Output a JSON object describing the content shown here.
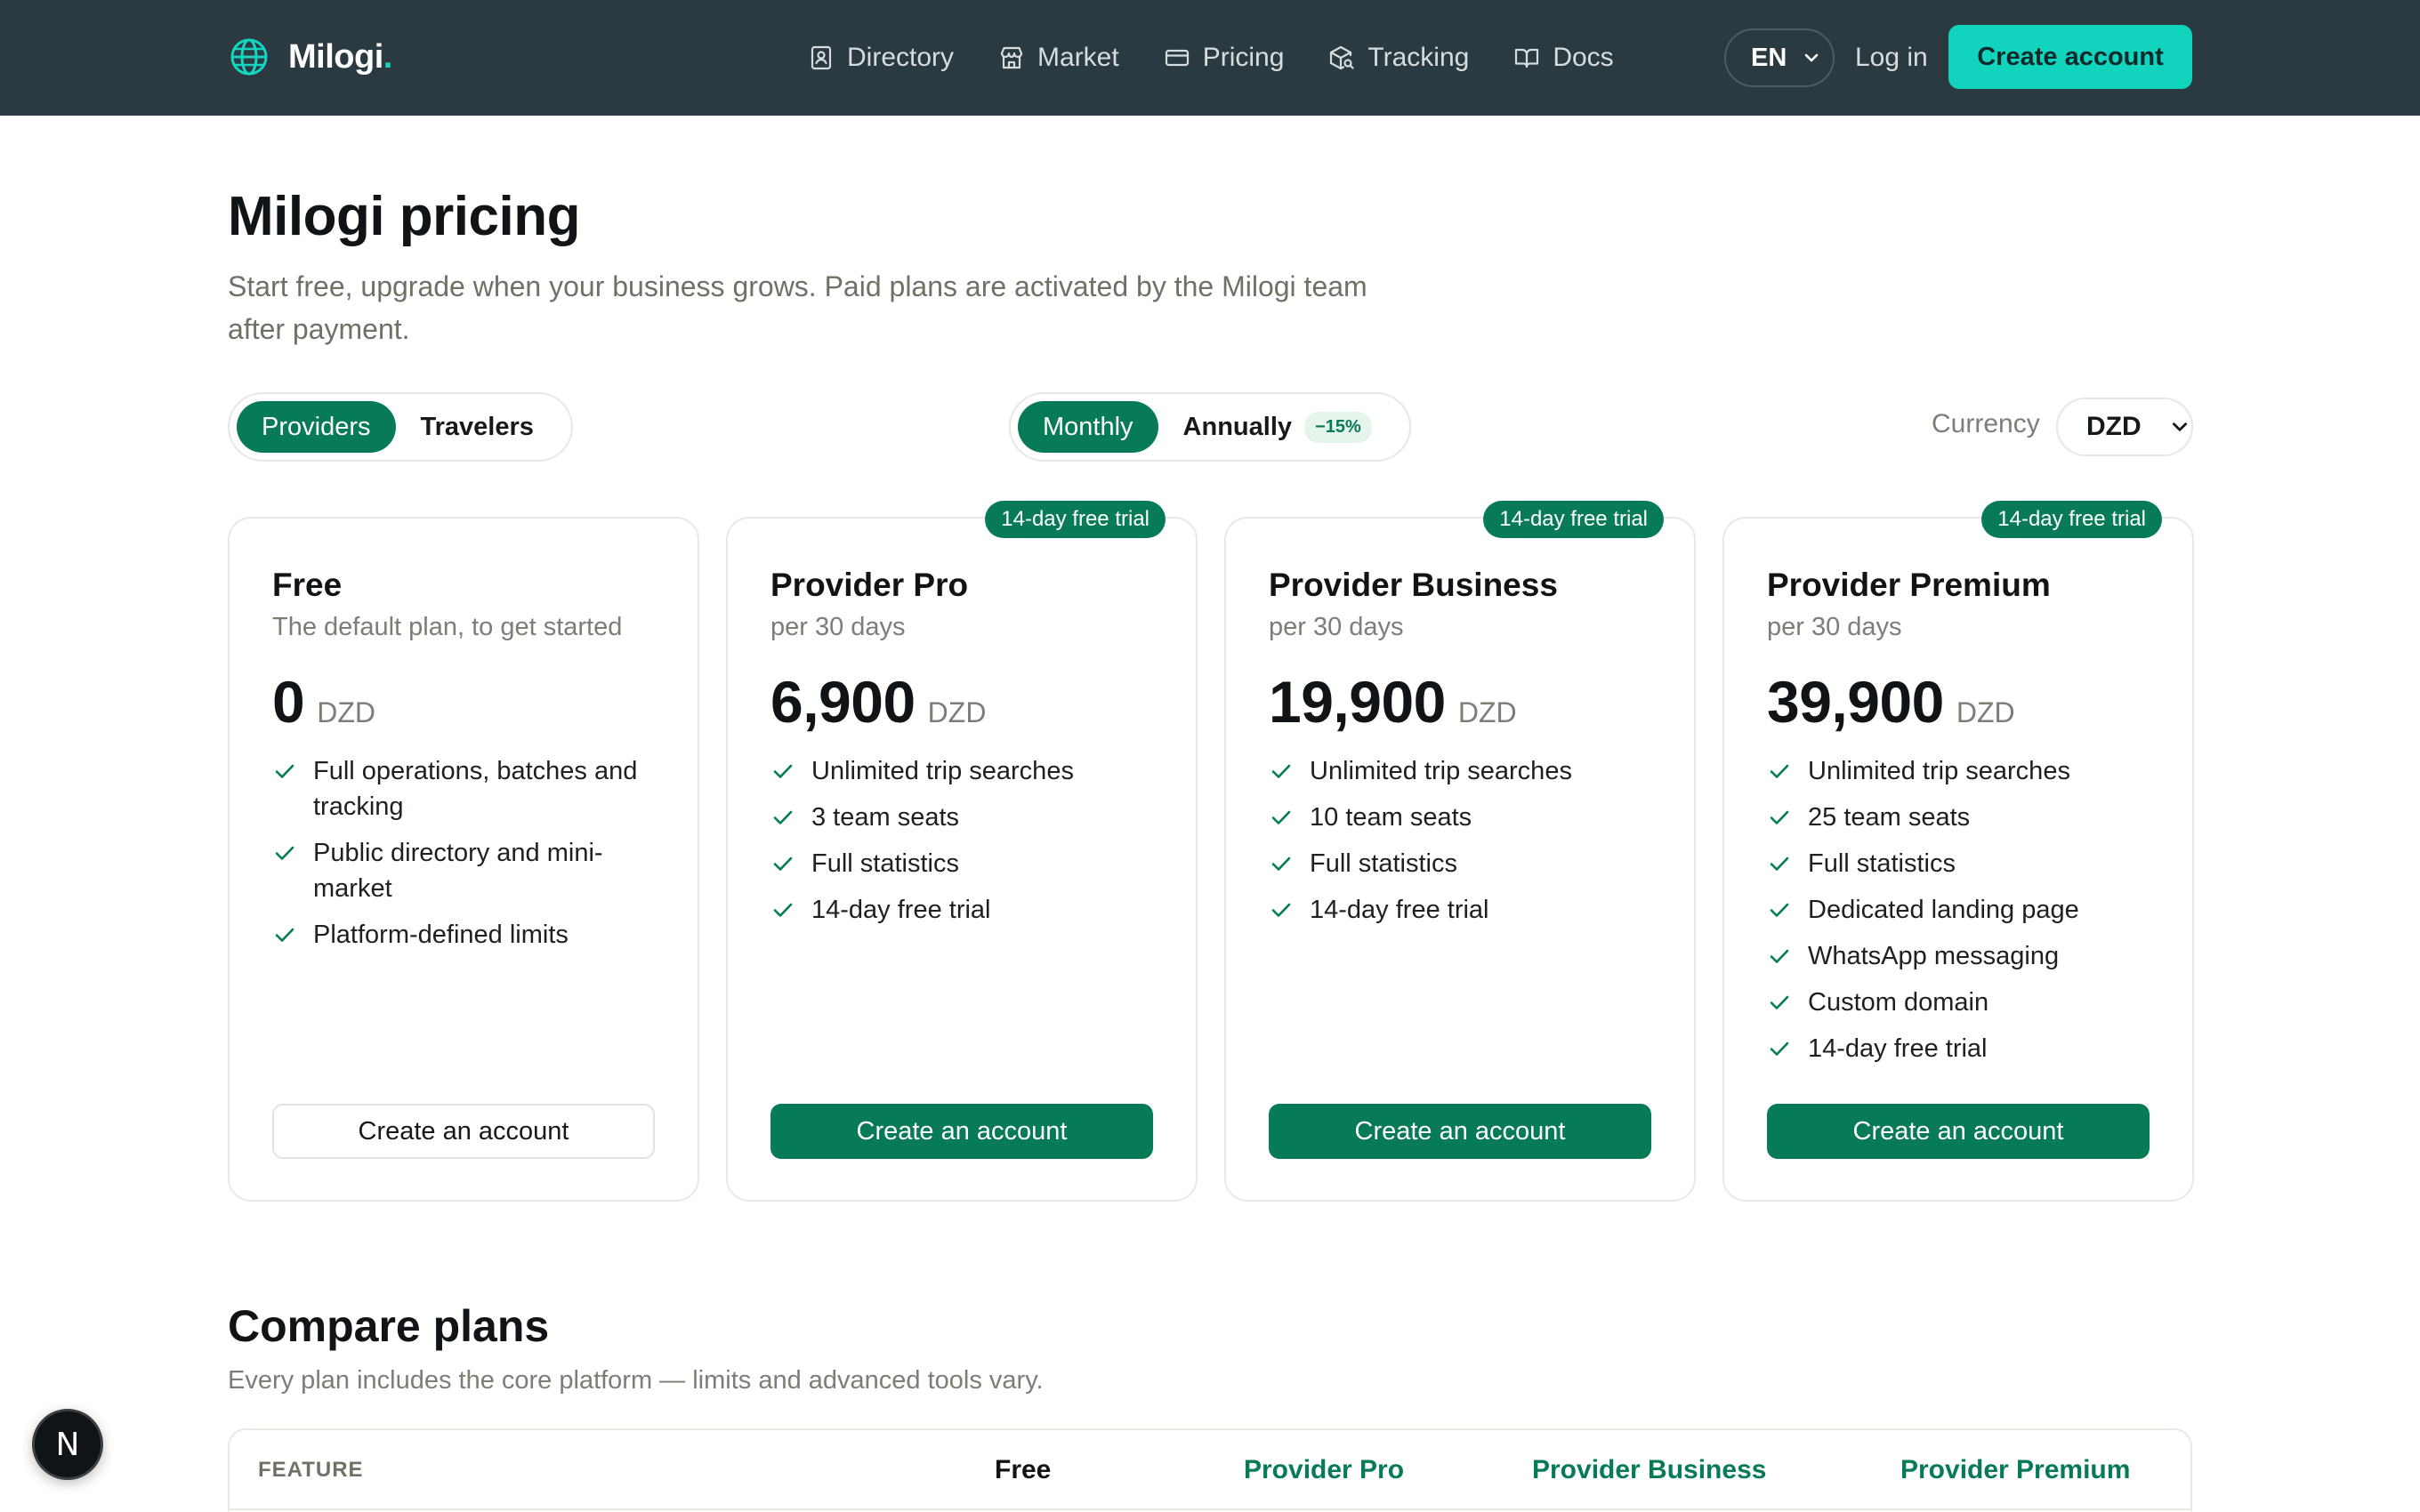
{
  "nav": {
    "brand": "Milogi",
    "brand_dot": ".",
    "links": [
      {
        "label": "Directory",
        "icon": "contact-book-icon"
      },
      {
        "label": "Market",
        "icon": "storefront-icon"
      },
      {
        "label": "Pricing",
        "icon": "credit-card-icon"
      },
      {
        "label": "Tracking",
        "icon": "package-search-icon"
      },
      {
        "label": "Docs",
        "icon": "book-open-icon"
      }
    ],
    "language": "EN",
    "login": "Log in",
    "create_account": "Create account"
  },
  "header": {
    "title": "Milogi pricing",
    "subtitle": "Start free, upgrade when your business grows. Paid plans are activated by the Milogi team after payment."
  },
  "audience_toggle": {
    "options": [
      "Providers",
      "Travelers"
    ],
    "selected": "Providers"
  },
  "billing_toggle": {
    "options": [
      "Monthly",
      "Annually"
    ],
    "selected": "Monthly",
    "annual_discount": "−15%"
  },
  "currency": {
    "label": "Currency",
    "value": "DZD"
  },
  "plans": [
    {
      "name": "Free",
      "subtitle": "The default plan, to get started",
      "price": "0",
      "currency": "DZD",
      "badge": "",
      "features": [
        "Full operations, batches and tracking",
        "Public directory and mini-market",
        "Platform-defined limits"
      ],
      "cta": "Create an account"
    },
    {
      "name": "Provider Pro",
      "subtitle": "per 30 days",
      "price": "6,900",
      "currency": "DZD",
      "badge": "14-day free trial",
      "features": [
        "Unlimited trip searches",
        "3 team seats",
        "Full statistics",
        "14-day free trial"
      ],
      "cta": "Create an account"
    },
    {
      "name": "Provider Business",
      "subtitle": "per 30 days",
      "price": "19,900",
      "currency": "DZD",
      "badge": "14-day free trial",
      "features": [
        "Unlimited trip searches",
        "10 team seats",
        "Full statistics",
        "14-day free trial"
      ],
      "cta": "Create an account"
    },
    {
      "name": "Provider Premium",
      "subtitle": "per 30 days",
      "price": "39,900",
      "currency": "DZD",
      "badge": "14-day free trial",
      "features": [
        "Unlimited trip searches",
        "25 team seats",
        "Full statistics",
        "Dedicated landing page",
        "WhatsApp messaging",
        "Custom domain",
        "14-day free trial"
      ],
      "cta": "Create an account"
    }
  ],
  "compare": {
    "title": "Compare plans",
    "subtitle": "Every plan includes the core platform — limits and advanced tools vary.",
    "columns": [
      "FEATURE",
      "Free",
      "Provider Pro",
      "Provider Business",
      "Provider Premium"
    ]
  },
  "dev_badge": "N",
  "colors": {
    "nav_bg": "#2b3a40",
    "accent": "#12d3bd",
    "primary": "#077a57"
  }
}
